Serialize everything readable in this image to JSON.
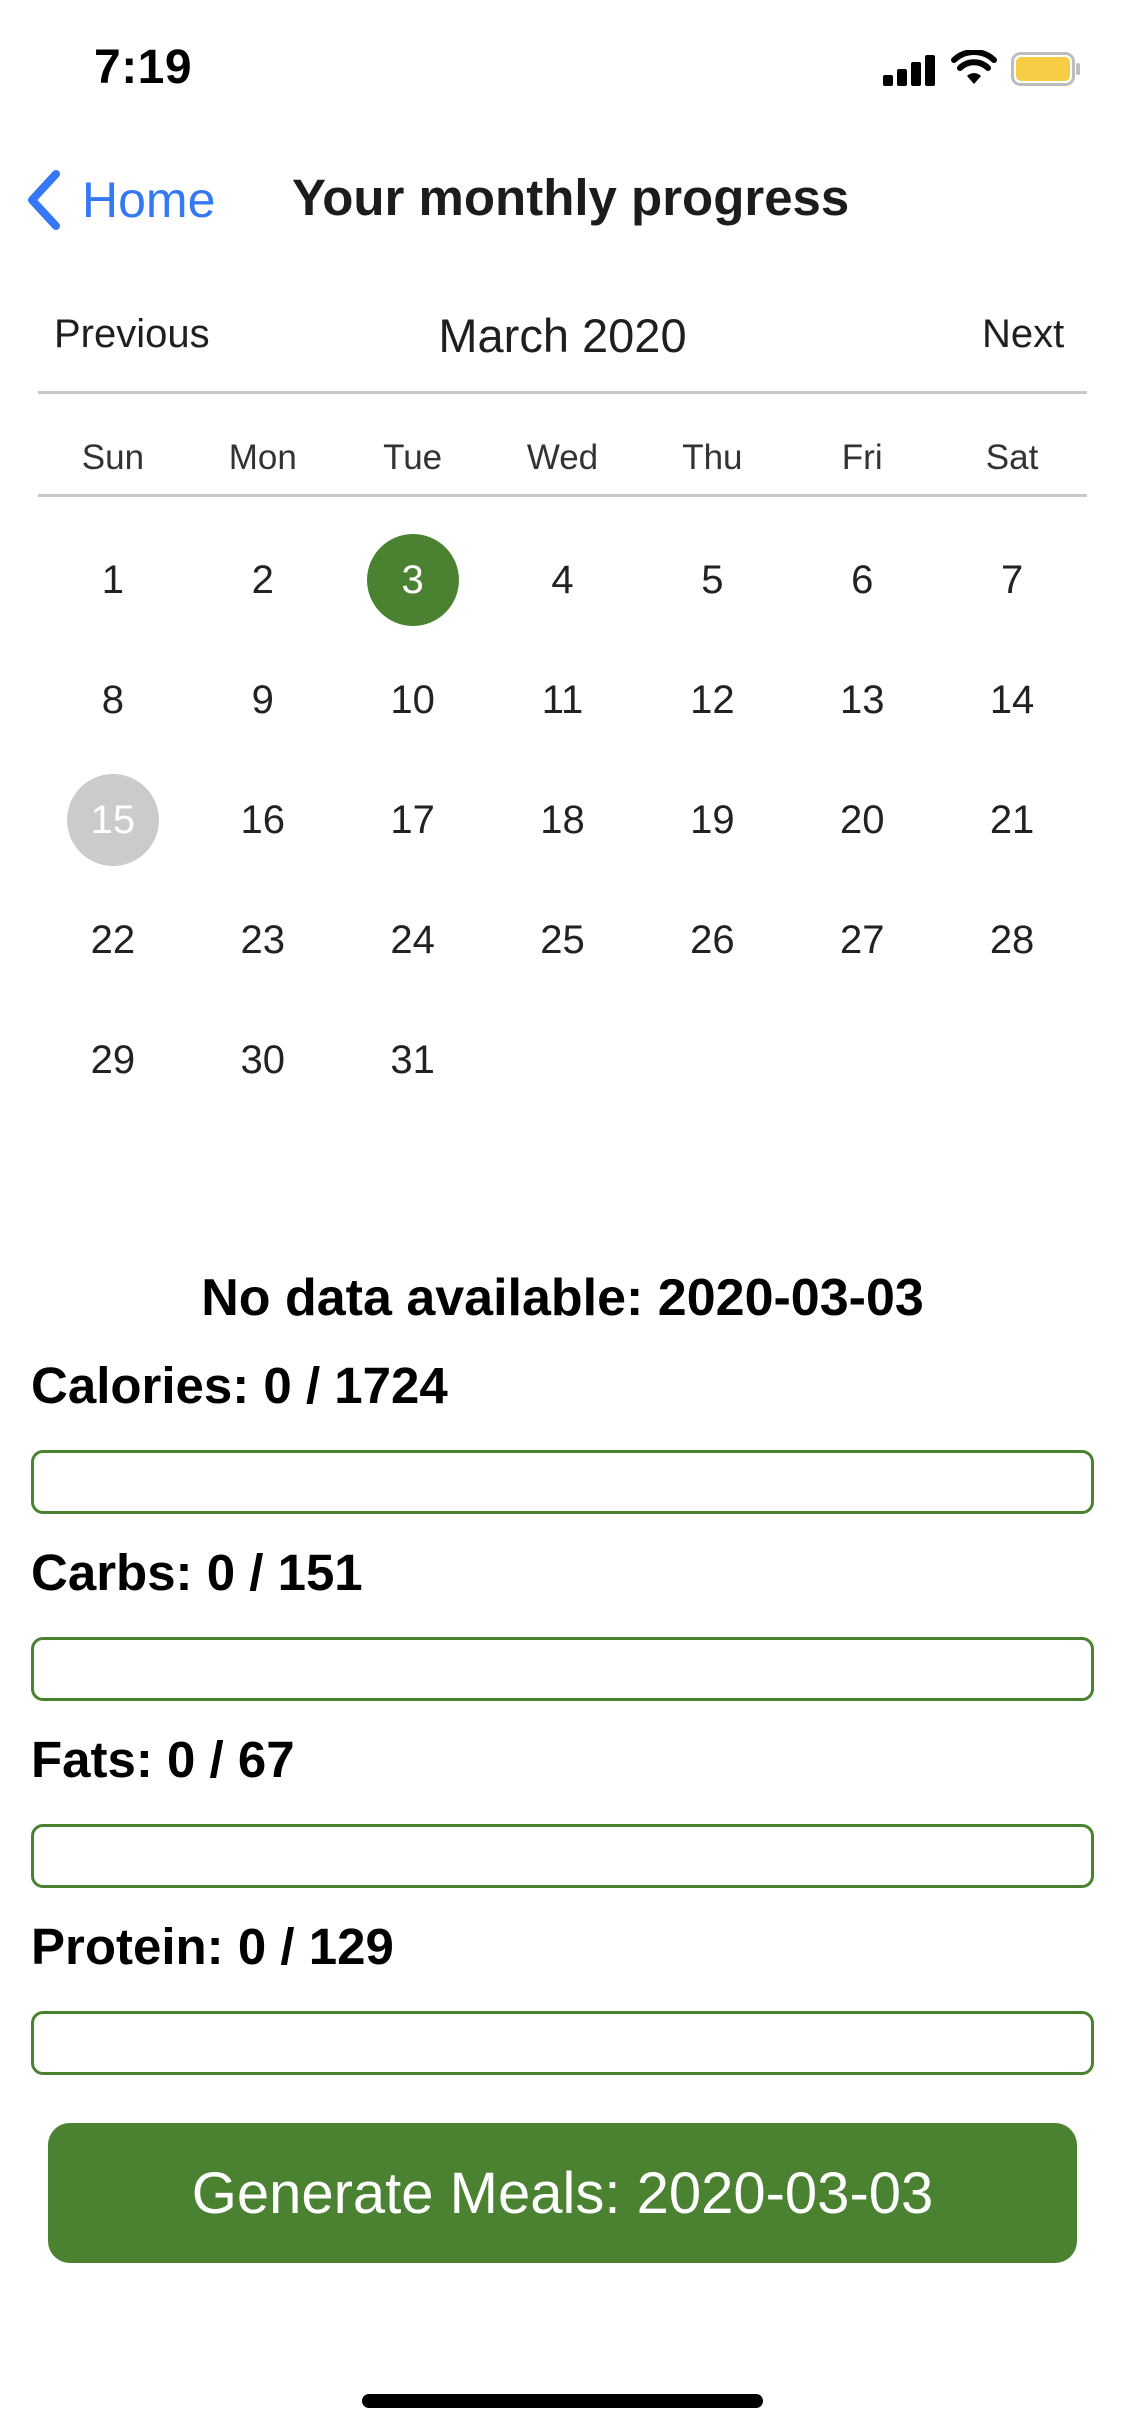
{
  "status_bar": {
    "time": "7:19",
    "battery_color": "#f7cd46"
  },
  "nav": {
    "back_label": "Home",
    "title": "Your monthly progress"
  },
  "calendar": {
    "prev_label": "Previous",
    "next_label": "Next",
    "month_title": "March 2020",
    "weekdays": [
      "Sun",
      "Mon",
      "Tue",
      "Wed",
      "Thu",
      "Fri",
      "Sat"
    ],
    "start_offset": 0,
    "days": [
      "1",
      "2",
      "3",
      "4",
      "5",
      "6",
      "7",
      "8",
      "9",
      "10",
      "11",
      "12",
      "13",
      "14",
      "15",
      "16",
      "17",
      "18",
      "19",
      "20",
      "21",
      "22",
      "23",
      "24",
      "25",
      "26",
      "27",
      "28",
      "29",
      "30",
      "31"
    ],
    "selected_day": "3",
    "today_day": "15",
    "selected_color": "#4b8231",
    "today_color": "#cbcbcb"
  },
  "summary": {
    "no_data_text": "No data available: 2020-03-03"
  },
  "nutrients": [
    {
      "label": "Calories: 0 / 1724",
      "progress": 0
    },
    {
      "label": "Carbs: 0 / 151",
      "progress": 0
    },
    {
      "label": "Fats: 0 / 67",
      "progress": 0
    },
    {
      "label": "Protein: 0 / 129",
      "progress": 0
    }
  ],
  "generate_button": {
    "label": "Generate Meals: 2020-03-03",
    "color": "#4b8231"
  }
}
